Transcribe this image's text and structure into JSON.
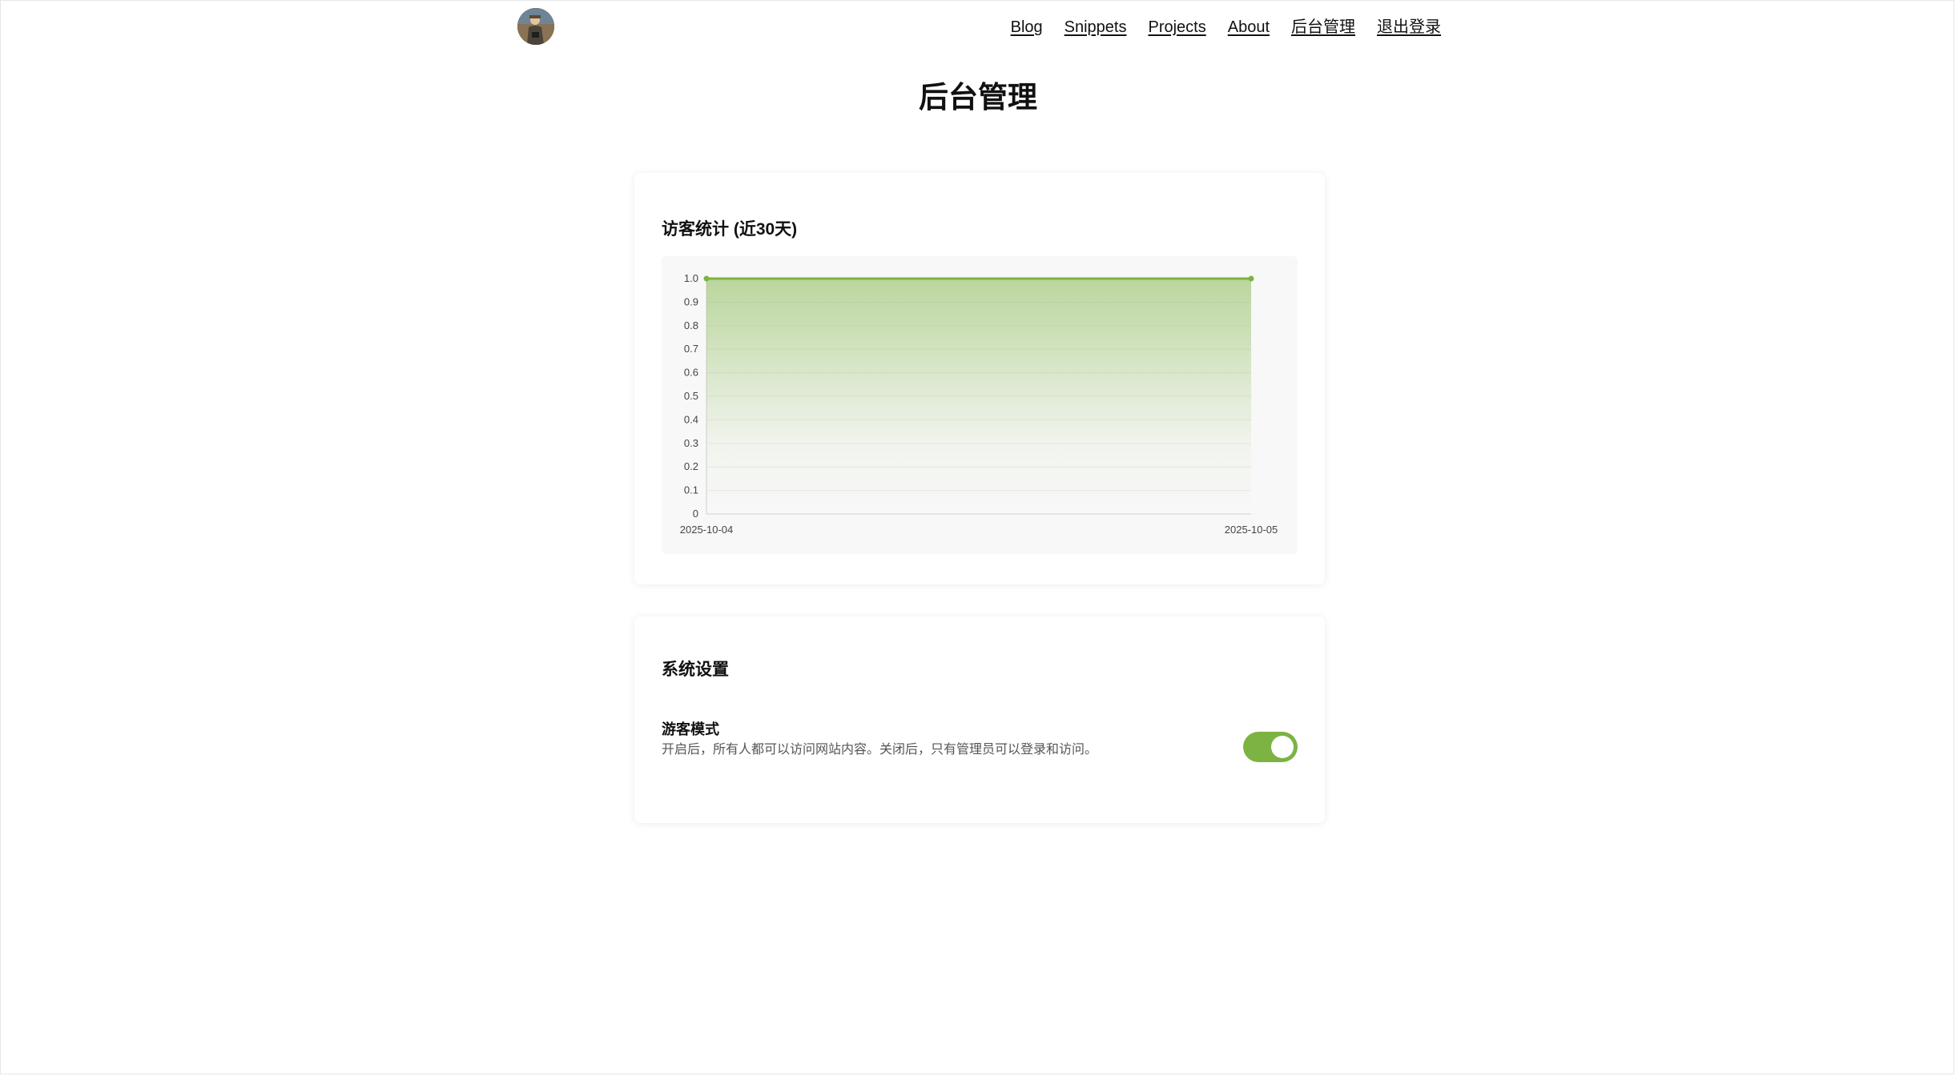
{
  "nav": {
    "items": [
      "Blog",
      "Snippets",
      "Projects",
      "About",
      "后台管理",
      "退出登录"
    ]
  },
  "page": {
    "title": "后台管理"
  },
  "stats": {
    "title": "访客统计 (近30天)"
  },
  "settings": {
    "title": "系统设置",
    "guest_mode": {
      "label": "游客模式",
      "description": "开启后，所有人都可以访问网站内容。关闭后，只有管理员可以登录和访问。",
      "enabled": true
    }
  },
  "colors": {
    "accent": "#7cb342",
    "toggle_on": "#7cb342"
  },
  "chart_data": {
    "type": "area",
    "x": [
      "2025-10-04",
      "2025-10-05"
    ],
    "series": [
      {
        "values": [
          1,
          1
        ]
      }
    ],
    "yticks": [
      "0",
      "0.1",
      "0.2",
      "0.3",
      "0.4",
      "0.5",
      "0.6",
      "0.7",
      "0.8",
      "0.9",
      "1.0"
    ],
    "ylim": [
      0,
      1
    ],
    "grid": true,
    "legend": "none"
  }
}
